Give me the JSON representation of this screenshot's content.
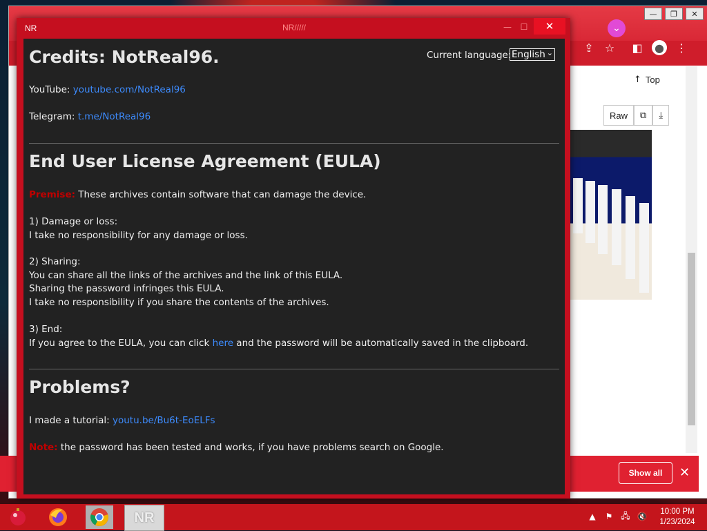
{
  "nr_window": {
    "title": "NR",
    "title_center": "NR/////",
    "close_glyph": "✕",
    "min_glyph": "—",
    "max_glyph": "☐"
  },
  "language": {
    "label": "Current language:",
    "selected": "English"
  },
  "credits": {
    "heading": "Credits: NotReal96.",
    "youtube_label": "YouTube:",
    "youtube_link": "youtube.com/NotReal96",
    "telegram_label": "Telegram:",
    "telegram_link": "t.me/NotReal96"
  },
  "eula": {
    "heading": "End User License Agreement (EULA)",
    "premise_label": "Premise:",
    "premise_text": "These archives contain software that can damage the device.",
    "s1_title": "1) Damage or loss:",
    "s1_line1": "I take no responsibility for any damage or loss.",
    "s2_title": "2) Sharing:",
    "s2_line1": "You can share all the links of the archives and the link of this EULA.",
    "s2_line2": "Sharing the password infringes this EULA.",
    "s2_line3": "I take no responsibility if you share the contents of the archives.",
    "s3_title": "3) End:",
    "s3_pre": "If you agree to the EULA, you can click",
    "s3_link": "here",
    "s3_post": "and the password will be automatically saved in the clipboard."
  },
  "problems": {
    "heading": "Problems?",
    "tutorial_label": "I made a tutorial:",
    "tutorial_link": "youtu.be/Bu6t-EoELFs",
    "note_label": "Note:",
    "note_text": "the password has been tested and works, if you have problems search on Google."
  },
  "browser": {
    "top_label": "Top",
    "raw_label": "Raw",
    "show_all_label": "Show all"
  },
  "taskbar": {
    "nr_label": "NR",
    "time": "10:00 PM",
    "date": "1/23/2024"
  },
  "colors": {
    "accent_red": "#c50f1f",
    "link_blue": "#3d8bfd",
    "warning_red": "#c00000",
    "dialog_bg": "#222222"
  }
}
